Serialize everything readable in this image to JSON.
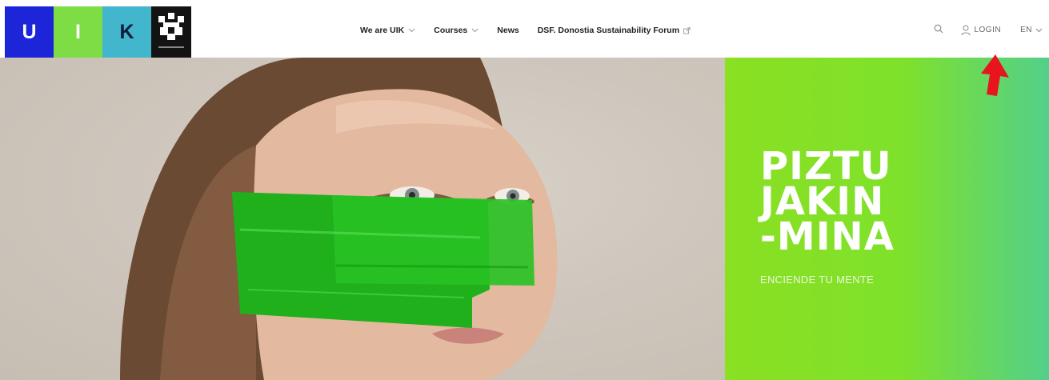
{
  "logo": {
    "letters": [
      "U",
      "I",
      "K"
    ],
    "colors": {
      "u": "#1c25d8",
      "i": "#7edc45",
      "k": "#41b6cc",
      "ehu": "#131313"
    }
  },
  "nav": {
    "items": [
      {
        "label": "We are UIK",
        "dropdown": true
      },
      {
        "label": "Courses",
        "dropdown": true
      },
      {
        "label": "News",
        "dropdown": false
      },
      {
        "label": "DSF. Donostia Sustainability Forum",
        "external": true
      }
    ]
  },
  "tools": {
    "search_icon": "search-icon",
    "login_label": "LOGIN",
    "language": "EN"
  },
  "hero": {
    "title_lines": [
      "PIZTU",
      "JAKIN",
      "-MINA"
    ],
    "subtitle": "ENCIENDE TU MENTE",
    "accent_color": "#8ae022"
  },
  "annotation": {
    "color": "#e8141e",
    "icon": "red-arrow-icon"
  }
}
